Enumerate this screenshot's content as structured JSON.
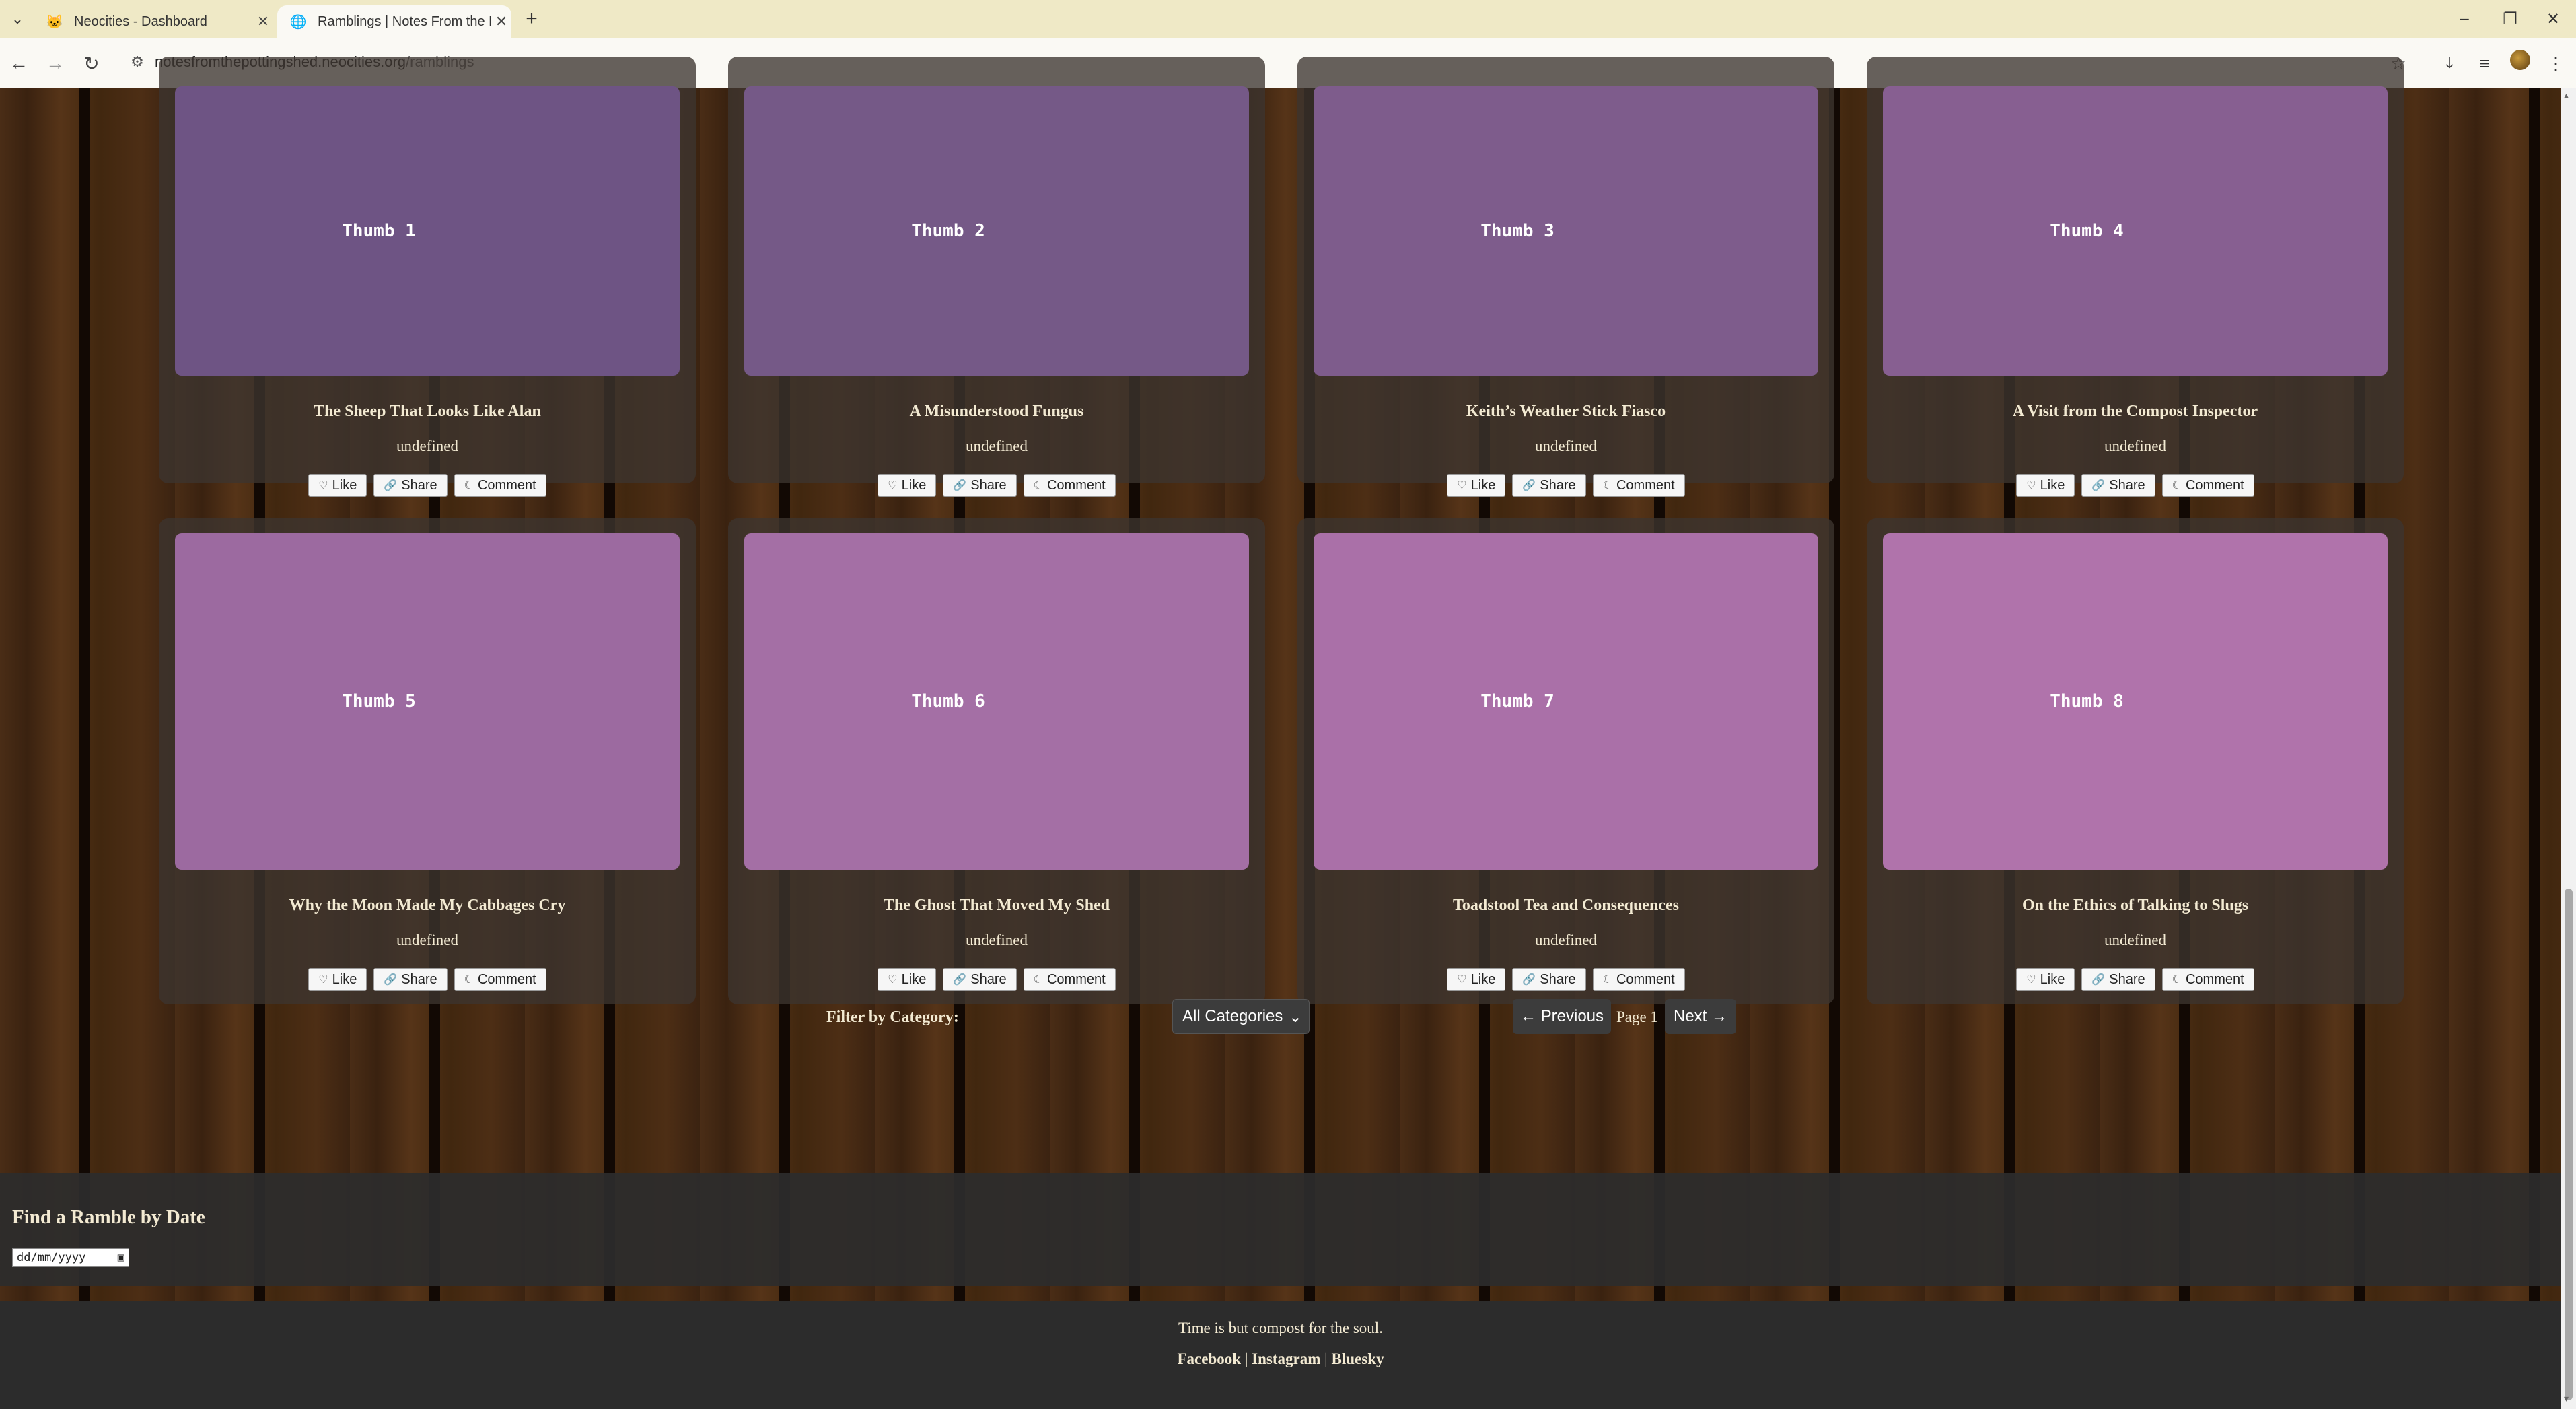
{
  "browser": {
    "tabs": [
      {
        "title": "Neocities - Dashboard",
        "icon": "neocities-cat-icon"
      },
      {
        "title": "Ramblings | Notes From the Po",
        "icon": "globe-icon"
      }
    ],
    "url_host": "notesfromthepottingshed.neocities.org",
    "url_path": "/ramblings"
  },
  "cards": [
    {
      "thumb": "Thumb 1",
      "title": "The Sheep That Looks Like Alan",
      "meta": "undefined",
      "color": "#6e5484"
    },
    {
      "thumb": "Thumb 2",
      "title": "A Misunderstood Fungus",
      "meta": "undefined",
      "color": "#755987"
    },
    {
      "thumb": "Thumb 3",
      "title": "Keith’s Weather Stick Fiasco",
      "meta": "undefined",
      "color": "#7e5c8c"
    },
    {
      "thumb": "Thumb 4",
      "title": "A Visit from the Compost Inspector",
      "meta": "undefined",
      "color": "#875f91"
    },
    {
      "thumb": "Thumb 5",
      "title": "Why the Moon Made My Cabbages Cry",
      "meta": "undefined",
      "color": "#9c6aa0"
    },
    {
      "thumb": "Thumb 6",
      "title": "The Ghost That Moved My Shed",
      "meta": "undefined",
      "color": "#a46fa5"
    },
    {
      "thumb": "Thumb 7",
      "title": "Toadstool Tea and Consequences",
      "meta": "undefined",
      "color": "#aa70a8"
    },
    {
      "thumb": "Thumb 8",
      "title": "On the Ethics of Talking to Slugs",
      "meta": "undefined",
      "color": "#b073ab"
    }
  ],
  "actions": {
    "like": "Like",
    "share": "Share",
    "comment": "Comment"
  },
  "filter": {
    "label": "Filter by Category:",
    "selected": "All Categories"
  },
  "pagination": {
    "prev": "← Previous",
    "page": "Page 1",
    "next": "Next →"
  },
  "date_search": {
    "title": "Find a Ramble by Date",
    "placeholder": "dd/mm/yyyy"
  },
  "footer": {
    "tagline": "Time is but compost for the soul.",
    "links": [
      "Facebook",
      "Instagram",
      "Bluesky"
    ]
  }
}
